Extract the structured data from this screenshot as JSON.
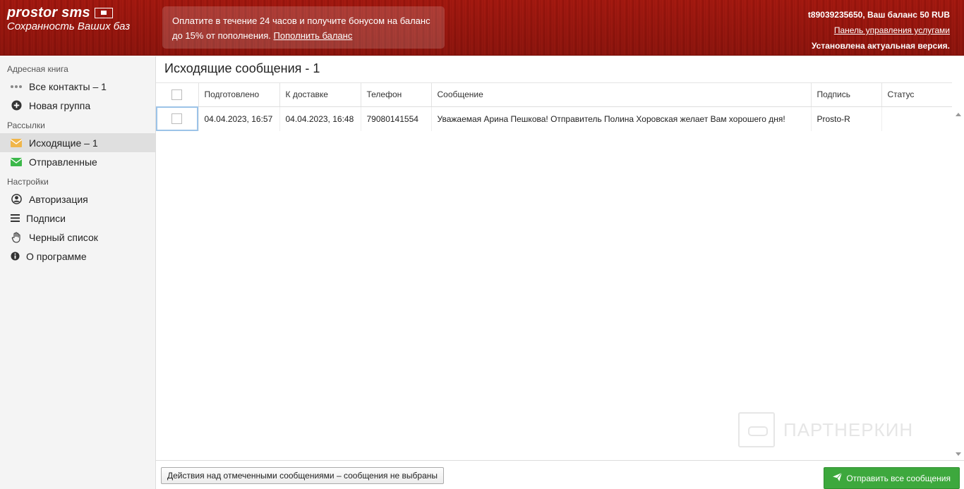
{
  "header": {
    "logo_title": "prostor sms",
    "logo_subtitle": "Сохранность Ваших баз",
    "promo_text": "Оплатите в течение 24 часов и получите бонусом на баланс до 15% от пополнения.",
    "promo_link": "Пополнить баланс",
    "account": "t89039235650, Ваш баланс 50 RUB",
    "services_link": "Панель управления услугами",
    "version": "Установлена актуальная версия."
  },
  "sidebar": {
    "address_book_title": "Адресная книга",
    "all_contacts": "Все контакты – 1",
    "new_group": "Новая группа",
    "mailings_title": "Рассылки",
    "outgoing": "Исходящие – 1",
    "sent": "Отправленные",
    "settings_title": "Настройки",
    "authorization": "Авторизация",
    "signatures": "Подписи",
    "blacklist": "Черный список",
    "about": "О программе"
  },
  "main": {
    "title": "Исходящие сообщения - 1",
    "columns": {
      "prepared": "Подготовлено",
      "delivery": "К доставке",
      "phone": "Телефон",
      "message": "Сообщение",
      "signature": "Подпись",
      "status": "Статус"
    },
    "rows": [
      {
        "prepared": "04.04.2023, 16:57",
        "delivery": "04.04.2023, 16:48",
        "phone": "79080141554",
        "message": "Уважаемая Арина Пешкова! Отправитель Полина Хоровская желает Вам хорошего дня!",
        "signature": "Prosto-R",
        "status": ""
      }
    ],
    "watermark": "ПАРТНЕРКИН"
  },
  "footer": {
    "actions_button": "Действия над отмеченными сообщениями – сообщения не выбраны",
    "send_all_button": "Отправить все сообщения"
  },
  "colors": {
    "header_red": "#a3170f",
    "send_green": "#3da83d",
    "outgoing_icon": "#f0b64a",
    "sent_icon": "#3cb84a"
  }
}
